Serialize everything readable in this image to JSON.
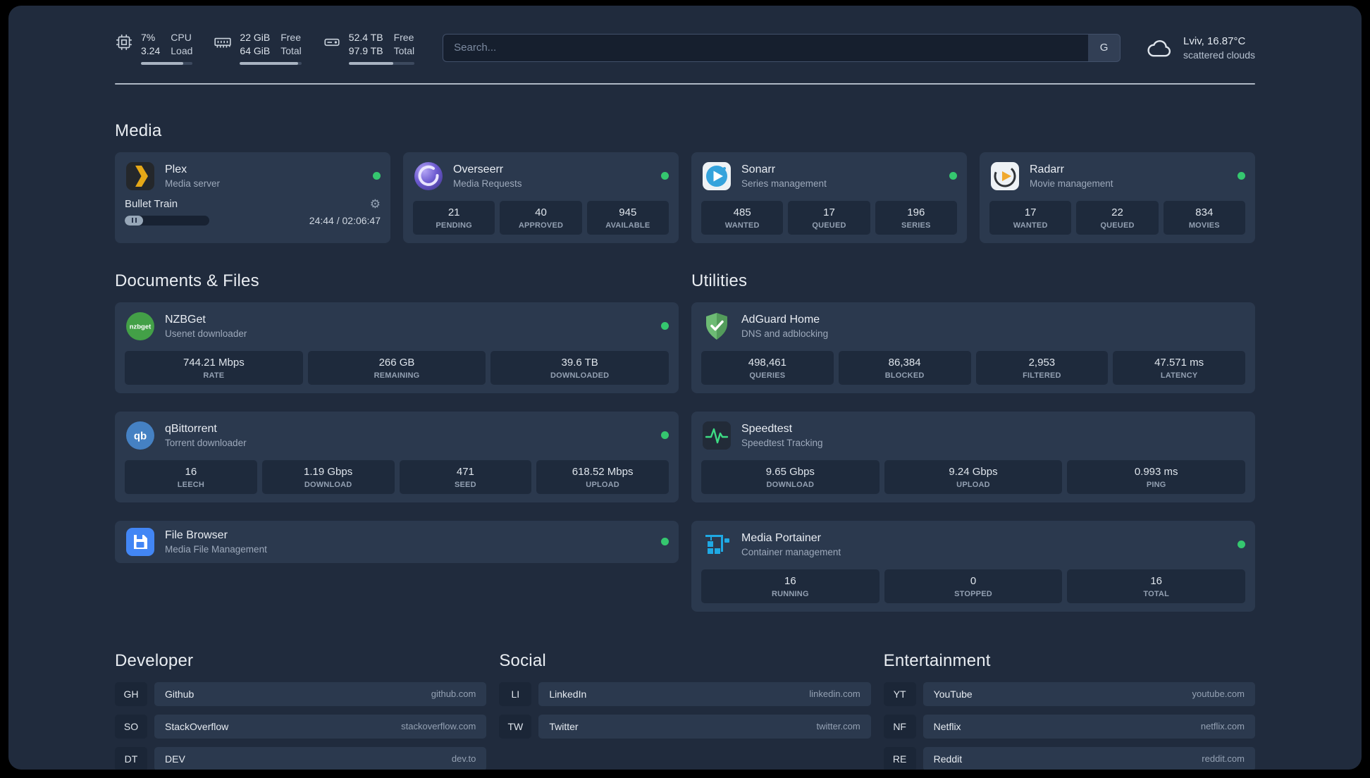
{
  "icons": {
    "gear": "⚙",
    "nzbget_text": "nzbget",
    "qbittorrent_text": "qb"
  },
  "topbar": {
    "cpu": {
      "value1": "7%",
      "value2": "3.24",
      "label1": "CPU",
      "label2": "Load",
      "progress": 82
    },
    "ram": {
      "value1": "22 GiB",
      "value2": "64 GiB",
      "label1": "Free",
      "label2": "Total",
      "progress": 95
    },
    "disk": {
      "value1": "52.4 TB",
      "value2": "97.9 TB",
      "label1": "Free",
      "label2": "Total",
      "progress": 68
    },
    "search": {
      "placeholder": "Search...",
      "button_label": "G"
    },
    "weather": {
      "location": "Lviv, 16.87°C",
      "condition": "scattered clouds"
    }
  },
  "media": {
    "title": "Media",
    "plex": {
      "name": "Plex",
      "subtitle": "Media server",
      "now_playing": "Bullet Train",
      "time": "24:44 / 02:06:47",
      "progress": 22
    },
    "overseerr": {
      "name": "Overseerr",
      "subtitle": "Media Requests",
      "stats": [
        {
          "value": "21",
          "label": "PENDING"
        },
        {
          "value": "40",
          "label": "APPROVED"
        },
        {
          "value": "945",
          "label": "AVAILABLE"
        }
      ]
    },
    "sonarr": {
      "name": "Sonarr",
      "subtitle": "Series management",
      "stats": [
        {
          "value": "485",
          "label": "WANTED"
        },
        {
          "value": "17",
          "label": "QUEUED"
        },
        {
          "value": "196",
          "label": "SERIES"
        }
      ]
    },
    "radarr": {
      "name": "Radarr",
      "subtitle": "Movie management",
      "stats": [
        {
          "value": "17",
          "label": "WANTED"
        },
        {
          "value": "22",
          "label": "QUEUED"
        },
        {
          "value": "834",
          "label": "MOVIES"
        }
      ]
    }
  },
  "documents": {
    "title": "Documents & Files",
    "nzbget": {
      "name": "NZBGet",
      "subtitle": "Usenet downloader",
      "stats": [
        {
          "value": "744.21 Mbps",
          "label": "RATE"
        },
        {
          "value": "266 GB",
          "label": "REMAINING"
        },
        {
          "value": "39.6 TB",
          "label": "DOWNLOADED"
        }
      ]
    },
    "qbittorrent": {
      "name": "qBittorrent",
      "subtitle": "Torrent downloader",
      "stats": [
        {
          "value": "16",
          "label": "LEECH"
        },
        {
          "value": "1.19 Gbps",
          "label": "DOWNLOAD"
        },
        {
          "value": "471",
          "label": "SEED"
        },
        {
          "value": "618.52 Mbps",
          "label": "UPLOAD"
        }
      ]
    },
    "filebrowser": {
      "name": "File Browser",
      "subtitle": "Media File Management"
    }
  },
  "utilities": {
    "title": "Utilities",
    "adguard": {
      "name": "AdGuard Home",
      "subtitle": "DNS and adblocking",
      "stats": [
        {
          "value": "498,461",
          "label": "QUERIES"
        },
        {
          "value": "86,384",
          "label": "BLOCKED"
        },
        {
          "value": "2,953",
          "label": "FILTERED"
        },
        {
          "value": "47.571 ms",
          "label": "LATENCY"
        }
      ]
    },
    "speedtest": {
      "name": "Speedtest",
      "subtitle": "Speedtest Tracking",
      "stats": [
        {
          "value": "9.65 Gbps",
          "label": "DOWNLOAD"
        },
        {
          "value": "9.24 Gbps",
          "label": "UPLOAD"
        },
        {
          "value": "0.993 ms",
          "label": "PING"
        }
      ]
    },
    "portainer": {
      "name": "Media Portainer",
      "subtitle": "Container management",
      "stats": [
        {
          "value": "16",
          "label": "RUNNING"
        },
        {
          "value": "0",
          "label": "STOPPED"
        },
        {
          "value": "16",
          "label": "TOTAL"
        }
      ]
    }
  },
  "bookmarks": {
    "developer": {
      "title": "Developer",
      "items": [
        {
          "abbr": "GH",
          "name": "Github",
          "domain": "github.com"
        },
        {
          "abbr": "SO",
          "name": "StackOverflow",
          "domain": "stackoverflow.com"
        },
        {
          "abbr": "DT",
          "name": "DEV",
          "domain": "dev.to"
        }
      ]
    },
    "social": {
      "title": "Social",
      "items": [
        {
          "abbr": "LI",
          "name": "LinkedIn",
          "domain": "linkedin.com"
        },
        {
          "abbr": "TW",
          "name": "Twitter",
          "domain": "twitter.com"
        }
      ]
    },
    "entertainment": {
      "title": "Entertainment",
      "items": [
        {
          "abbr": "YT",
          "name": "YouTube",
          "domain": "youtube.com"
        },
        {
          "abbr": "NF",
          "name": "Netflix",
          "domain": "netflix.com"
        },
        {
          "abbr": "RE",
          "name": "Reddit",
          "domain": "reddit.com"
        }
      ]
    }
  }
}
